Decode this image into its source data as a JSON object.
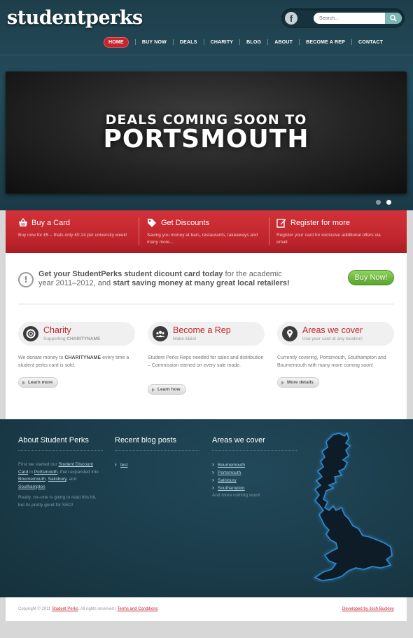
{
  "brand": {
    "logo": "studentperks"
  },
  "header": {
    "social_icon": "facebook-icon",
    "search": {
      "placeholder": "Search...",
      "icon": "search-icon"
    },
    "nav": [
      "HOME",
      "BUY NOW",
      "DEALS",
      "CHARITY",
      "BLOG",
      "ABOUT",
      "BECOME A REP",
      "CONTACT"
    ],
    "active_nav": "HOME"
  },
  "slider": {
    "line1": "DEALS COMING SOON TO",
    "line2": "PORTSMOUTH",
    "dots": 2,
    "active_dot": 2
  },
  "features": [
    {
      "icon": "basket-icon",
      "title": "Buy a Card",
      "desc": "Buy now for £5 – thats only £0.14 per university week!"
    },
    {
      "icon": "tag-icon",
      "title": "Get Discounts",
      "desc": "Saving you money at bars, restaurants, takeaways and many more..."
    },
    {
      "icon": "edit-icon",
      "title": "Register for more",
      "desc": "Register your card for exclusive additional offers via email"
    }
  ],
  "cta": {
    "icon": "exclamation-icon",
    "bold1": "Get your StudentPerks student dicount card today",
    "text1": " for the academic year 2011–2012, and ",
    "bold2": "start saving money at many great local retailers!",
    "button": "Buy Now!"
  },
  "columns": [
    {
      "icon": "lifebuoy-icon",
      "title": "Charity",
      "sub_pre": "Supporting ",
      "sub_bold": "CHARITYNAME",
      "desc_pre": "We donate money to ",
      "desc_bold": "CHARITYNAME",
      "desc_post": " every time a student perks card is sold.",
      "button": "Learn more"
    },
    {
      "icon": "group-icon",
      "title": "Become a Rep",
      "sub_pre": "Make £££s!",
      "sub_bold": "",
      "desc_pre": "Student Perks Reps needed for sales and distribution – Commission earned on every sale made.",
      "desc_bold": "",
      "desc_post": "",
      "button": "Learn how"
    },
    {
      "icon": "map-pin-icon",
      "title": "Areas we cover",
      "sub_pre": "Use your card at any location!",
      "sub_bold": "",
      "desc_pre": "Currently covering, Portsmouth, Southampton and Bournemouth with many more coming soon!",
      "desc_bold": "",
      "desc_post": "",
      "button": "More details"
    }
  ],
  "footer": {
    "about": {
      "title": "About Student Perks",
      "p1_a": "First we started our ",
      "p1_link1": "Student Discount Card",
      "p1_b": " in ",
      "p1_link2": "Portsmouth",
      "p1_c": ", then expanded into ",
      "p1_link3": "Bournemouth",
      "p1_d": ", ",
      "p1_link4": "Salisbury",
      "p1_e": ", and ",
      "p1_link5": "Southampton",
      "p2": "Really, no–one is going to read this bit, but its pretty good for SEO!"
    },
    "blog": {
      "title": "Recent blog posts",
      "items": [
        "test"
      ]
    },
    "areas": {
      "title": "Areas we cover",
      "items": [
        "Bournemouth",
        "Portsmouth",
        "Salisbury",
        "Southampton"
      ],
      "more": "And more coming soon!"
    }
  },
  "bottom": {
    "copy_pre": "Copyright © 2011 ",
    "copy_link": "Student Perks",
    "copy_mid": ". All rights reserved  |  ",
    "terms": "Terms and Conditions",
    "dev": "Developed by Josh Buckley"
  }
}
